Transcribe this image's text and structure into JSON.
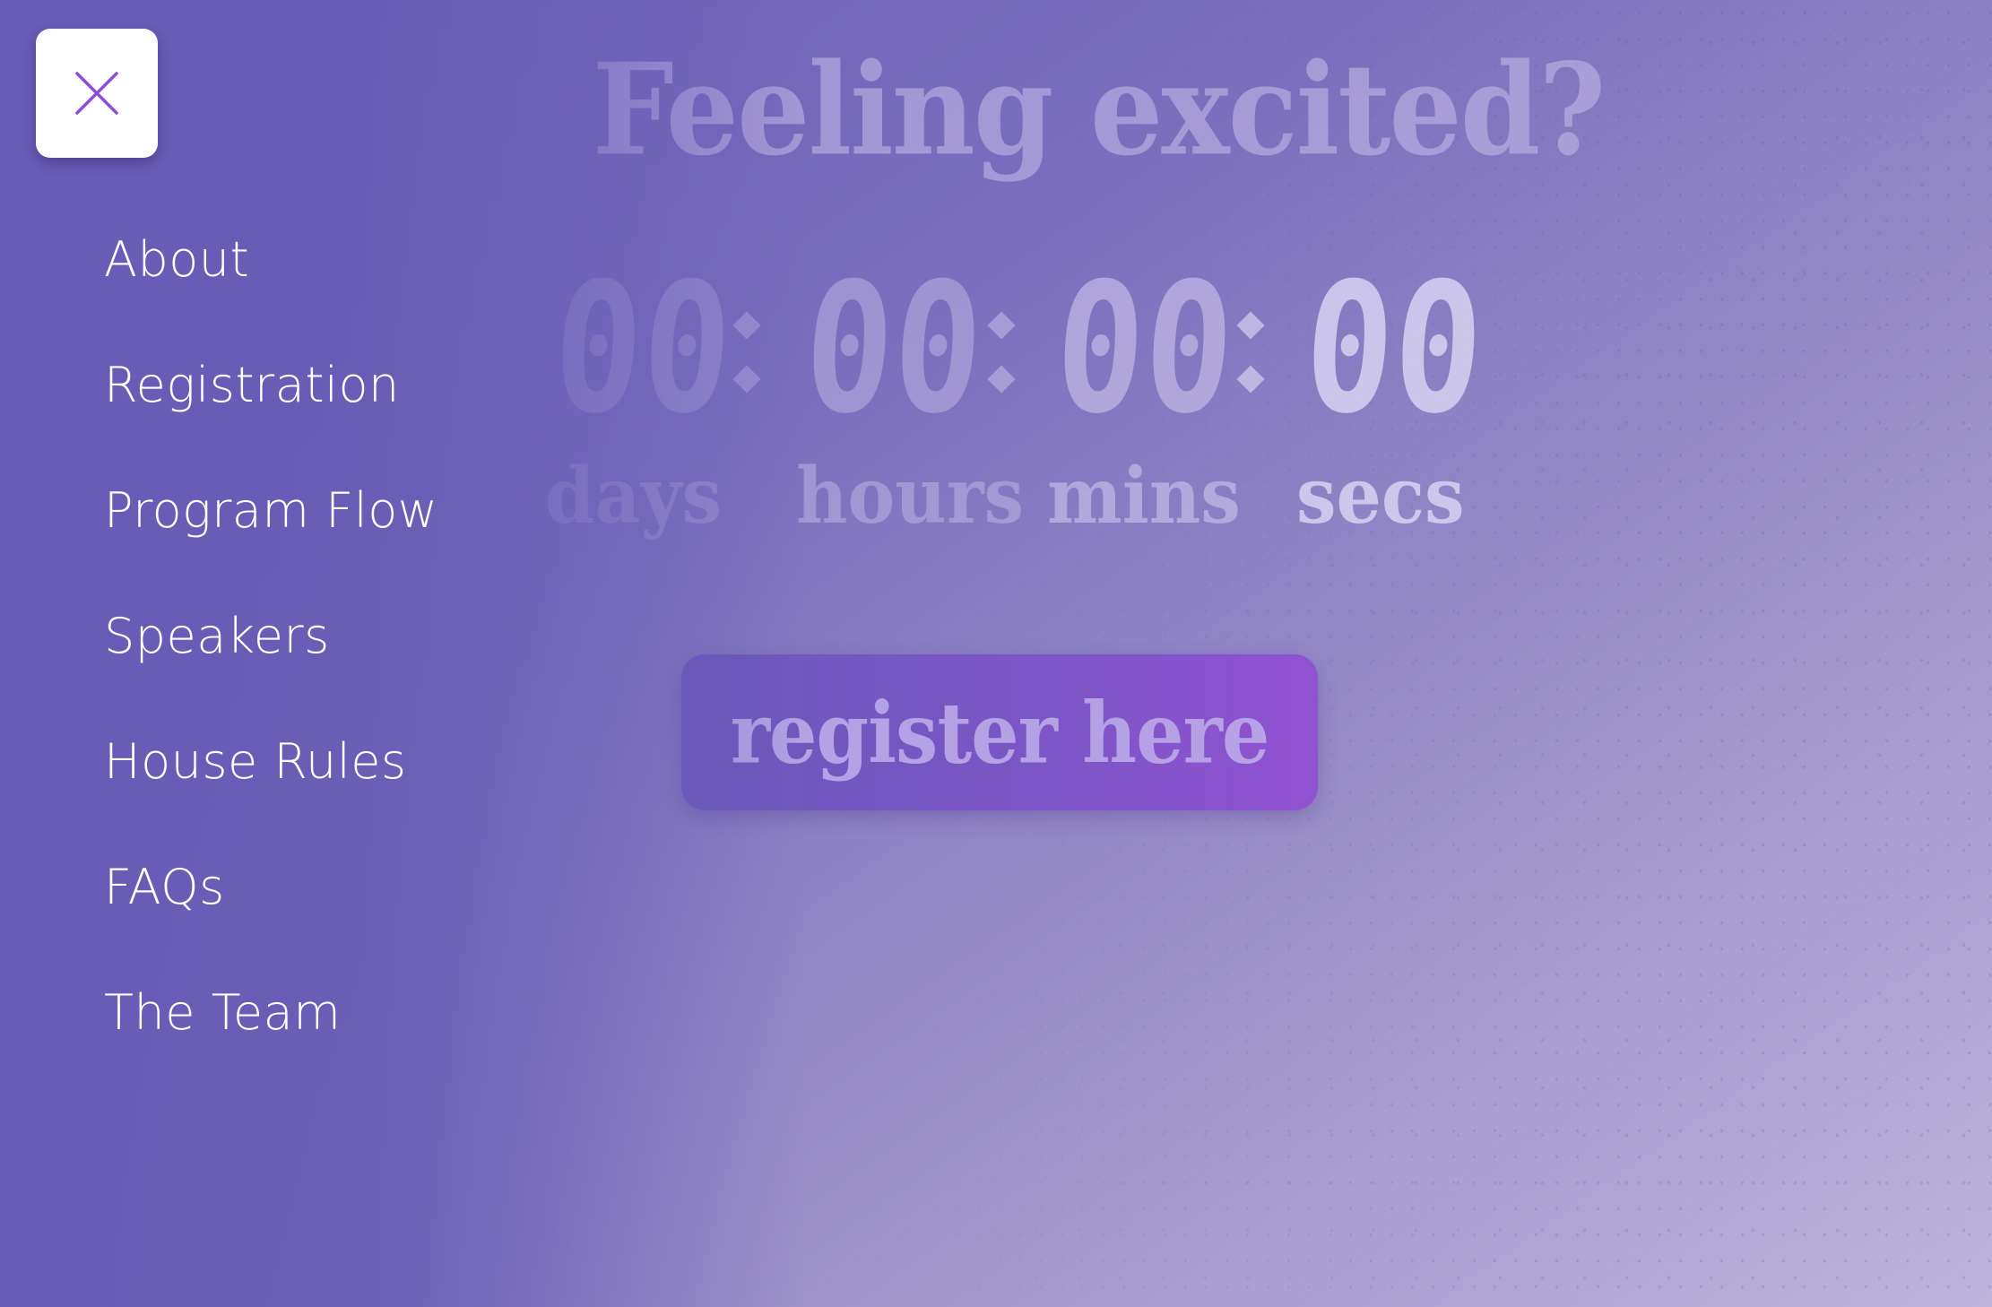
{
  "hero": {
    "headline": "Feeling excited?",
    "countdown": [
      {
        "value": "00",
        "label": "days"
      },
      {
        "value": "00",
        "label": "hours"
      },
      {
        "value": "00",
        "label": "mins"
      },
      {
        "value": "00",
        "label": "secs"
      }
    ],
    "register_label": "register here"
  },
  "menu": {
    "close_icon": "close-icon",
    "items": [
      {
        "label": "About"
      },
      {
        "label": "Registration"
      },
      {
        "label": "Program Flow"
      },
      {
        "label": "Speakers"
      },
      {
        "label": "House Rules"
      },
      {
        "label": "FAQs"
      },
      {
        "label": "The Team"
      }
    ]
  },
  "colors": {
    "accent": "#8b4fd6",
    "background": "#6a5cb6",
    "menu_text": "#ffffff"
  }
}
